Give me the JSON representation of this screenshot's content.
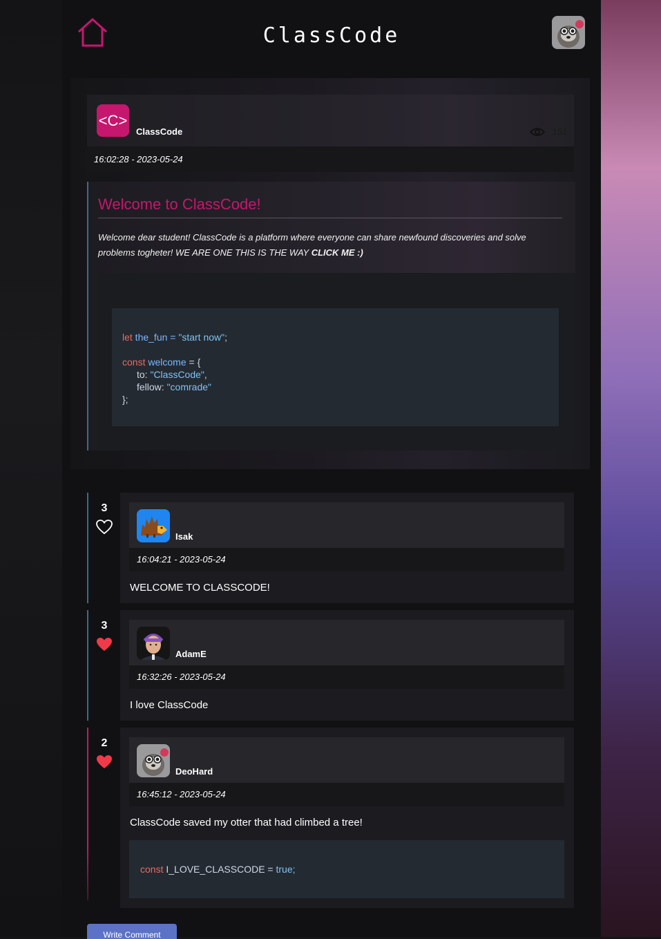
{
  "header": {
    "logo": "ClassCode",
    "home_icon": "home-icon",
    "avatar_icon": "otter-avatar"
  },
  "post": {
    "author": "ClassCode",
    "logo_text": "<C>",
    "views": "151",
    "date": "16:02:28 - 2023-05-24",
    "title": "Welcome to ClassCode!",
    "body_prefix": "Welcome dear student! ClassCode is a platform where everyone can share newfound discoveries and solve problems togheter! WE ARE ONE THIS IS THE WAY ",
    "body_link": "CLICK ME :)",
    "code": {
      "line1_kw": "let",
      "line1_rest": " the_fun = ",
      "line1_str": "\"start now\"",
      "line1_end": ";",
      "line2_kw": "const",
      "line2_ident": " welcome",
      "line2_rest": " = {",
      "line3_key": "to: ",
      "line3_str": "\"ClassCode\"",
      "line3_end": ",",
      "line4_key": "fellow: ",
      "line4_str": "\"comrade\"",
      "line5": "};"
    }
  },
  "comments": [
    {
      "likes": "3",
      "liked": false,
      "author": "Isak",
      "date": "16:04:21 - 2023-05-24",
      "text": "WELCOME TO CLASSCODE!",
      "avatar": "hedgehog-avatar"
    },
    {
      "likes": "3",
      "liked": true,
      "author": "AdamE",
      "date": "16:32:26 - 2023-05-24",
      "text": "I love ClassCode",
      "avatar": "person-avatar"
    },
    {
      "likes": "2",
      "liked": true,
      "author": "DeoHard",
      "date": "16:45:12 - 2023-05-24",
      "text": "ClassCode saved my otter that had climbed a tree!",
      "avatar": "otter-avatar",
      "code": {
        "kw": "const",
        "rest": " I_LOVE_CLASSCODE = ",
        "val": "true;"
      }
    }
  ],
  "write_button": "Write Comment",
  "colors": {
    "accent": "#c5176e",
    "rail_blue": "#3f6b87",
    "rail_pink": "#c5176e",
    "heart_red": "#f03a4a",
    "button": "#5b72c6"
  }
}
